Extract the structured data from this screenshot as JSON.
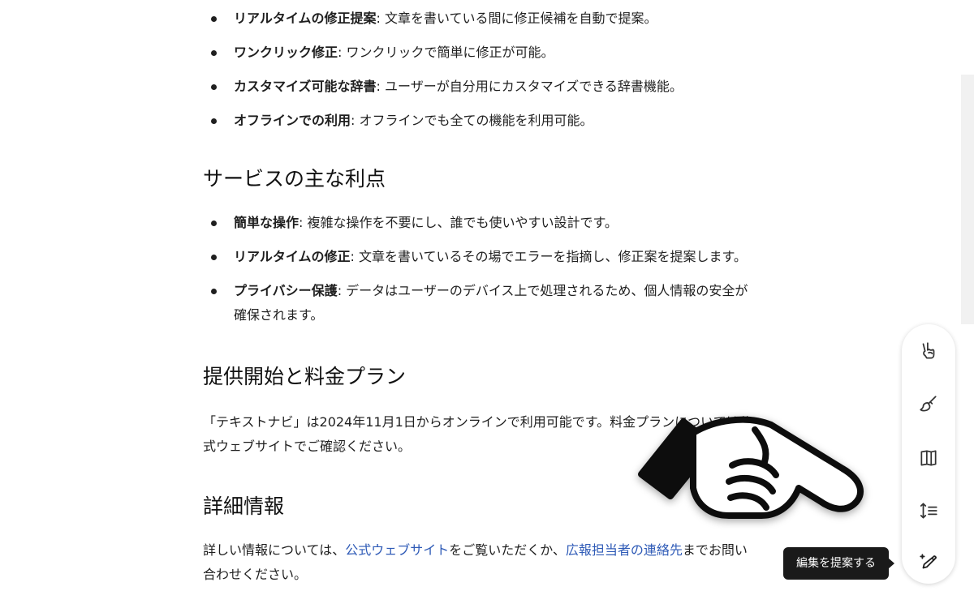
{
  "section1": {
    "items": [
      {
        "term": "リアルタイムの修正提案",
        "desc": ": 文章を書いている間に修正候補を自動で提案。"
      },
      {
        "term": "ワンクリック修正",
        "desc": ": ワンクリックで簡単に修正が可能。"
      },
      {
        "term": "カスタマイズ可能な辞書",
        "desc": ": ユーザーが自分用にカスタマイズできる辞書機能。"
      },
      {
        "term": "オフラインでの利用",
        "desc": ": オフラインでも全ての機能を利用可能。"
      }
    ]
  },
  "section2": {
    "title": "サービスの主な利点",
    "items": [
      {
        "term": "簡単な操作",
        "desc": ": 複雑な操作を不要にし、誰でも使いやすい設計です。"
      },
      {
        "term": "リアルタイムの修正",
        "desc": ": 文章を書いているその場でエラーを指摘し、修正案を提案します。"
      },
      {
        "term": "プライバシー保護",
        "desc": ": データはユーザーのデバイス上で処理されるため、個人情報の安全が確保されます。"
      }
    ]
  },
  "section3": {
    "title": "提供開始と料金プラン",
    "text": "「テキストナビ」は2024年11月1日からオンラインで利用可能です。料金プランについては公式ウェブサイトでご確認ください。"
  },
  "section4": {
    "title": "詳細情報",
    "text_before": "詳しい情報については、",
    "link1": "公式ウェブサイト",
    "text_middle": "をご覧いただくか、",
    "link2": "広報担当者の連絡先",
    "text_after": "までお問い合わせください。"
  },
  "toolbar": {
    "tooltip": "編集を提案する",
    "buttons": [
      {
        "icon": "peace-hand-icon"
      },
      {
        "icon": "paintbrush-icon"
      },
      {
        "icon": "book-icon"
      },
      {
        "icon": "line-spacing-icon"
      },
      {
        "icon": "pen-sparkle-icon"
      }
    ]
  },
  "colors": {
    "link": "#2f5bb7",
    "text": "#1f1f1f",
    "tooltip_bg": "#1a1a1a"
  }
}
